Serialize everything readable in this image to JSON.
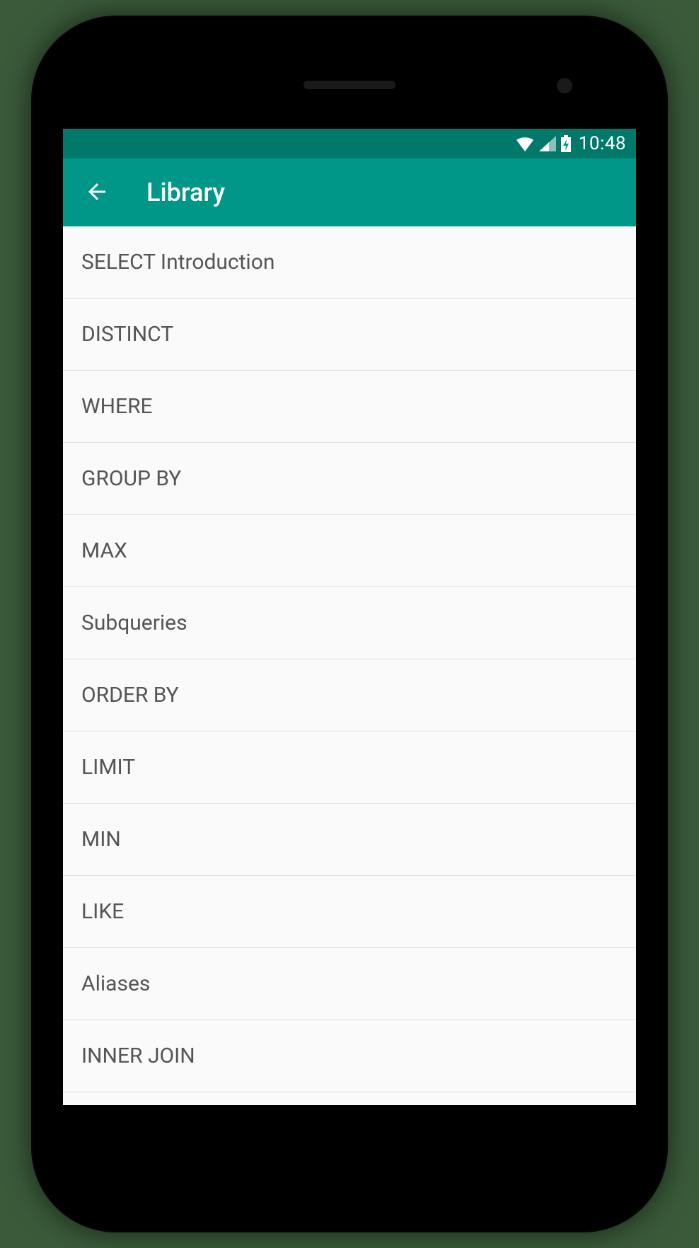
{
  "statusbar": {
    "time": "10:48"
  },
  "appbar": {
    "title": "Library"
  },
  "list": {
    "items": [
      {
        "label": "SELECT Introduction"
      },
      {
        "label": "DISTINCT"
      },
      {
        "label": "WHERE"
      },
      {
        "label": "GROUP BY"
      },
      {
        "label": "MAX"
      },
      {
        "label": "Subqueries"
      },
      {
        "label": "ORDER BY"
      },
      {
        "label": "LIMIT"
      },
      {
        "label": "MIN"
      },
      {
        "label": "LIKE"
      },
      {
        "label": "Aliases"
      },
      {
        "label": "INNER JOIN"
      }
    ]
  }
}
